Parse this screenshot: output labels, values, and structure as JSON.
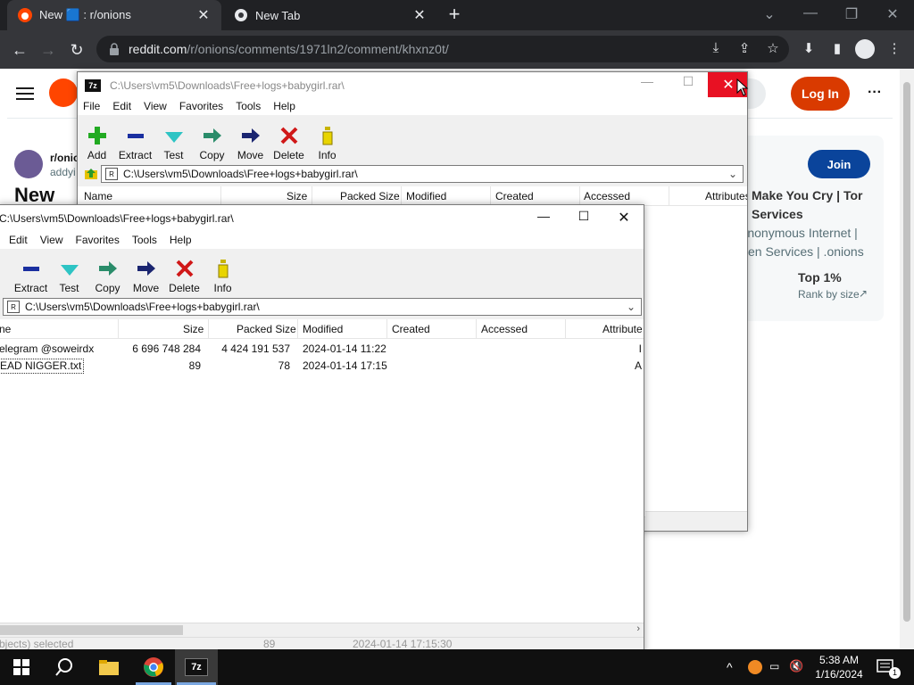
{
  "browser": {
    "tabs": [
      {
        "title": "New 🟦 : r/onions",
        "active": true
      },
      {
        "title": "New Tab",
        "active": false
      }
    ],
    "url_host": "reddit.com",
    "url_path": "/r/onions/comments/1971ln2/comment/khxnz0t/"
  },
  "reddit": {
    "login_label": "Log In",
    "more_label": "···",
    "subreddit": "r/onio",
    "user": "addyi",
    "post_title_partial": "New",
    "join_label": "Join",
    "sidebar_title_1": "Make You Cry | Tor",
    "sidebar_title_2": "Services",
    "sidebar_desc_1": "Anonymous Internet |",
    "sidebar_desc_2": "en Services | .onions",
    "sidebar_rank_value": "Top 1%",
    "sidebar_rank_label": "Rank by size"
  },
  "zip_back": {
    "title": "C:\\Users\\vm5\\Downloads\\Free+logs+babygirl.rar\\",
    "menu": [
      "File",
      "Edit",
      "View",
      "Favorites",
      "Tools",
      "Help"
    ],
    "tools": [
      "Add",
      "Extract",
      "Test",
      "Copy",
      "Move",
      "Delete",
      "Info"
    ],
    "address": "C:\\Users\\vm5\\Downloads\\Free+logs+babygirl.rar\\",
    "columns": [
      "Name",
      "Size",
      "Packed Size",
      "Modified",
      "Created",
      "Accessed",
      "Attributes"
    ]
  },
  "zip_front": {
    "title": "C:\\Users\\vm5\\Downloads\\Free+logs+babygirl.rar\\",
    "menu": [
      "Edit",
      "View",
      "Favorites",
      "Tools",
      "Help"
    ],
    "tools": [
      "Extract",
      "Test",
      "Copy",
      "Move",
      "Delete",
      "Info"
    ],
    "address": "C:\\Users\\vm5\\Downloads\\Free+logs+babygirl.rar\\",
    "columns": [
      "ne",
      "Size",
      "Packed Size",
      "Modified",
      "Created",
      "Accessed",
      "Attribute"
    ],
    "rows": [
      {
        "name": "elegram @soweirdx",
        "size": "6 696 748 284",
        "packed": "4 424 191 537",
        "modified": "2024-01-14 11:22",
        "attr": "I"
      },
      {
        "name": "EAD NIGGER.txt",
        "size": "89",
        "packed": "78",
        "modified": "2024-01-14 17:15",
        "attr": "A"
      }
    ],
    "status_selected": "bjects) selected",
    "status_size": "89",
    "status_date": "2024-01-14 17:15:30"
  },
  "taskbar": {
    "time": "5:38 AM",
    "date": "1/16/2024",
    "notification_count": "1"
  }
}
